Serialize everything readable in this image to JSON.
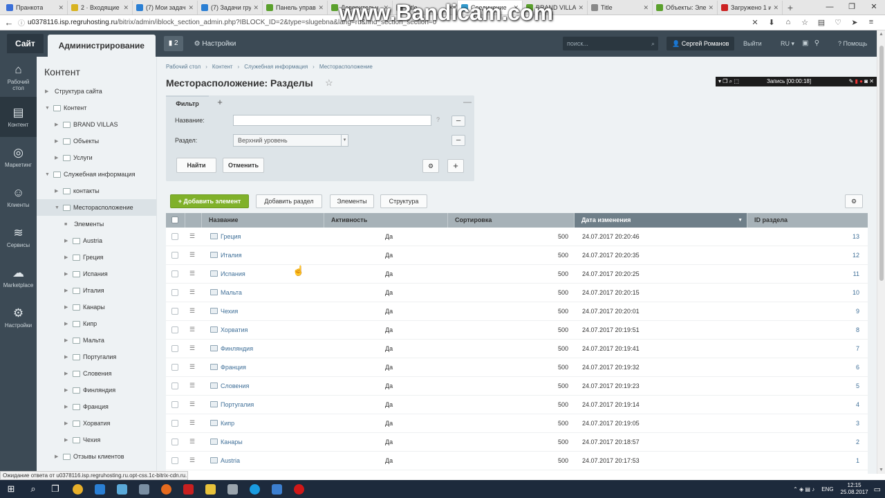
{
  "browser": {
    "tabs": [
      {
        "title": "Пранкота",
        "color": "#3a6fd8"
      },
      {
        "title": "2 · Входящие ·",
        "color": "#d8b320"
      },
      {
        "title": "(7) Мои задачи",
        "color": "#2a7fd4"
      },
      {
        "title": "(7) Задачи груп",
        "color": "#2a7fd4"
      },
      {
        "title": "Панель управ",
        "color": "#5aa02c"
      },
      {
        "title": "Доверительн",
        "color": "#5aa02c"
      },
      {
        "title": "Title",
        "color": "#888888"
      },
      {
        "title": "Соединение",
        "color": "#3399cc"
      },
      {
        "title": "BRAND VILLAS",
        "color": "#5aa02c"
      },
      {
        "title": "Title",
        "color": "#888888"
      },
      {
        "title": "Объекты: Элем",
        "color": "#5aa02c"
      },
      {
        "title": "Загружено 1 и",
        "color": "#cc2222"
      }
    ],
    "url_host": "u0378116.isp.regruhosting.ru",
    "url_path": "/bitrix/admin/iblock_section_admin.php?IBLOCK_ID=2&type=slugebna&lang=ru&find_section_section=0",
    "status_text": "Ожидание ответа от u0378116.isp.regruhosting.ru.opt-css.1c-bitrix-cdn.ru..."
  },
  "recorder": {
    "watermark": "www.Bandicam.com",
    "rec_label": "Запись [00:00:18]"
  },
  "topbar": {
    "site": "Сайт",
    "admin": "Администрирование",
    "notif_count": "2",
    "settings": "Настройки",
    "search_placeholder": "поиск...",
    "user": "Сергей Романов",
    "logout": "Выйти",
    "lang": "RU",
    "help": "Помощь"
  },
  "leftnav": [
    {
      "label": "Рабочий стол",
      "icon": "home-icon"
    },
    {
      "label": "Контент",
      "icon": "document-icon"
    },
    {
      "label": "Маркетинг",
      "icon": "target-icon"
    },
    {
      "label": "Клиенты",
      "icon": "clients-icon"
    },
    {
      "label": "Сервисы",
      "icon": "layers-icon"
    },
    {
      "label": "Marketplace",
      "icon": "cloud-icon"
    },
    {
      "label": "Настройки",
      "icon": "gear-icon"
    }
  ],
  "tree": {
    "title": "Контент",
    "items": [
      {
        "label": "Структура сайта",
        "level": 1,
        "arrow": "▶",
        "folder": false
      },
      {
        "label": "Контент",
        "level": 1,
        "arrow": "▼",
        "folder": true
      },
      {
        "label": "BRAND VILLAS",
        "level": 2,
        "arrow": "▶",
        "folder": true
      },
      {
        "label": "Объекты",
        "level": 2,
        "arrow": "▶",
        "folder": true
      },
      {
        "label": "Услуги",
        "level": 2,
        "arrow": "▶",
        "folder": true
      },
      {
        "label": "Служебная информация",
        "level": 1,
        "arrow": "▼",
        "folder": true
      },
      {
        "label": "контакты",
        "level": 2,
        "arrow": "▶",
        "folder": true
      },
      {
        "label": "Месторасположение",
        "level": 2,
        "arrow": "▼",
        "folder": true
      },
      {
        "label": "Элементы",
        "level": 3,
        "arrow": "■",
        "folder": false
      },
      {
        "label": "Austria",
        "level": 3,
        "arrow": "▶",
        "folder": true
      },
      {
        "label": "Греция",
        "level": 3,
        "arrow": "▶",
        "folder": true
      },
      {
        "label": "Испания",
        "level": 3,
        "arrow": "▶",
        "folder": true
      },
      {
        "label": "Италия",
        "level": 3,
        "arrow": "▶",
        "folder": true
      },
      {
        "label": "Канары",
        "level": 3,
        "arrow": "▶",
        "folder": true
      },
      {
        "label": "Кипр",
        "level": 3,
        "arrow": "▶",
        "folder": true
      },
      {
        "label": "Мальта",
        "level": 3,
        "arrow": "▶",
        "folder": true
      },
      {
        "label": "Португалия",
        "level": 3,
        "arrow": "▶",
        "folder": true
      },
      {
        "label": "Словения",
        "level": 3,
        "arrow": "▶",
        "folder": true
      },
      {
        "label": "Финляндия",
        "level": 3,
        "arrow": "▶",
        "folder": true
      },
      {
        "label": "Франция",
        "level": 3,
        "arrow": "▶",
        "folder": true
      },
      {
        "label": "Хорватия",
        "level": 3,
        "arrow": "▶",
        "folder": true
      },
      {
        "label": "Чехия",
        "level": 3,
        "arrow": "▶",
        "folder": true
      },
      {
        "label": "Отзывы клиентов",
        "level": 2,
        "arrow": "▶",
        "folder": true
      }
    ],
    "selected_index": 7
  },
  "main": {
    "breadcrumbs": [
      "Рабочий стол",
      "Контент",
      "Служебная информация",
      "Месторасположение"
    ],
    "title": "Месторасположение: Разделы",
    "filter": {
      "tab": "Фильтр",
      "name_label": "Название:",
      "section_label": "Раздел:",
      "section_value": "Верхний уровень",
      "find": "Найти",
      "cancel": "Отменить"
    },
    "buttons": {
      "add_element": "Добавить элемент",
      "add_section": "Добавить раздел",
      "elements": "Элементы",
      "structure": "Структура"
    },
    "columns": [
      "Название",
      "Активность",
      "Сортировка",
      "Дата изменения",
      "ID раздела"
    ],
    "rows": [
      {
        "name": "Греция",
        "active": "Да",
        "sort": "500",
        "date": "24.07.2017 20:20:46",
        "id": "13"
      },
      {
        "name": "Италия",
        "active": "Да",
        "sort": "500",
        "date": "24.07.2017 20:20:35",
        "id": "12"
      },
      {
        "name": "Испания",
        "active": "Да",
        "sort": "500",
        "date": "24.07.2017 20:20:25",
        "id": "11"
      },
      {
        "name": "Мальта",
        "active": "Да",
        "sort": "500",
        "date": "24.07.2017 20:20:15",
        "id": "10"
      },
      {
        "name": "Чехия",
        "active": "Да",
        "sort": "500",
        "date": "24.07.2017 20:20:01",
        "id": "9"
      },
      {
        "name": "Хорватия",
        "active": "Да",
        "sort": "500",
        "date": "24.07.2017 20:19:51",
        "id": "8"
      },
      {
        "name": "Финляндия",
        "active": "Да",
        "sort": "500",
        "date": "24.07.2017 20:19:41",
        "id": "7"
      },
      {
        "name": "Франция",
        "active": "Да",
        "sort": "500",
        "date": "24.07.2017 20:19:32",
        "id": "6"
      },
      {
        "name": "Словения",
        "active": "Да",
        "sort": "500",
        "date": "24.07.2017 20:19:23",
        "id": "5"
      },
      {
        "name": "Португалия",
        "active": "Да",
        "sort": "500",
        "date": "24.07.2017 20:19:14",
        "id": "4"
      },
      {
        "name": "Кипр",
        "active": "Да",
        "sort": "500",
        "date": "24.07.2017 20:19:05",
        "id": "3"
      },
      {
        "name": "Канары",
        "active": "Да",
        "sort": "500",
        "date": "24.07.2017 20:18:57",
        "id": "2"
      },
      {
        "name": "Austria",
        "active": "Да",
        "sort": "500",
        "date": "24.07.2017 20:17:53",
        "id": "1"
      }
    ]
  },
  "taskbar": {
    "lang": "ENG",
    "time": "12:15",
    "date": "25.08.2017"
  },
  "colors": {
    "accent_green": "#80b12a",
    "admin_dark": "#3c4a55",
    "link": "#3f6f98"
  }
}
